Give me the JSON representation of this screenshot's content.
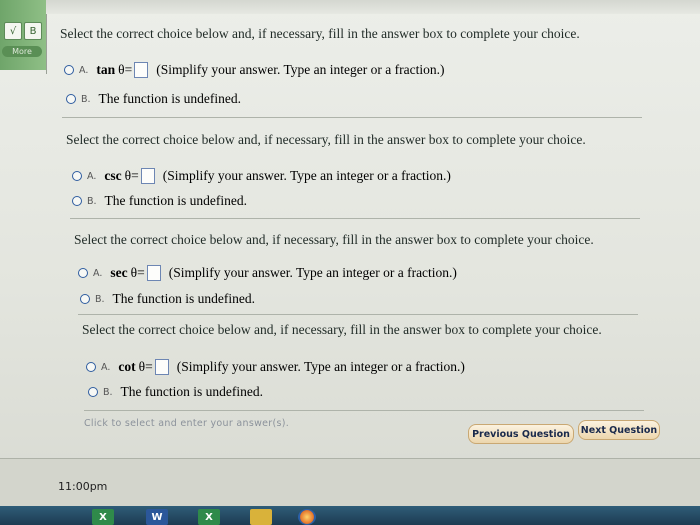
{
  "sidebar": {
    "tool1": "√",
    "tool2": "B",
    "more_label": "More"
  },
  "questions": [
    {
      "prompt": "Select the correct choice below and, if necessary, fill in the answer box to complete your choice.",
      "option_a_letter": "A.",
      "function": "tan",
      "theta": "θ",
      "equals": "=",
      "answer_value": "",
      "instruction": "(Simplify your answer. Type an integer or a fraction.)",
      "option_b_letter": "B.",
      "option_b_text": "The function is undefined."
    },
    {
      "prompt": "Select the correct choice below and, if necessary, fill in the answer box to complete your choice.",
      "option_a_letter": "A.",
      "function": "csc",
      "theta": "θ",
      "equals": "=",
      "answer_value": "",
      "instruction": "(Simplify your answer. Type an integer or a fraction.)",
      "option_b_letter": "B.",
      "option_b_text": "The function is undefined."
    },
    {
      "prompt": "Select the correct choice below and, if necessary, fill in the answer box to complete your choice.",
      "option_a_letter": "A.",
      "function": "sec",
      "theta": "θ",
      "equals": "=",
      "answer_value": "",
      "instruction": "(Simplify your answer. Type an integer or a fraction.)",
      "option_b_letter": "B.",
      "option_b_text": "The function is undefined."
    },
    {
      "prompt": "Select the correct choice below and, if necessary, fill in the answer box to complete your choice.",
      "option_a_letter": "A.",
      "function": "cot",
      "theta": "θ",
      "equals": "=",
      "answer_value": "",
      "instruction": "(Simplify your answer. Type an integer or a fraction.)",
      "option_b_letter": "B.",
      "option_b_text": "The function is undefined."
    }
  ],
  "hint": "Click to select and enter your answer(s).",
  "buttons": {
    "previous": "Previous Question",
    "next": "Next Question"
  },
  "footer": {
    "time": "11:00pm"
  },
  "taskbar": {
    "excel": "X",
    "word": "W",
    "excel2": "X"
  },
  "colors": {
    "radio_border": "#2f5da0",
    "button_text": "#1a2a4c",
    "accent_green": "#6fa56a"
  }
}
